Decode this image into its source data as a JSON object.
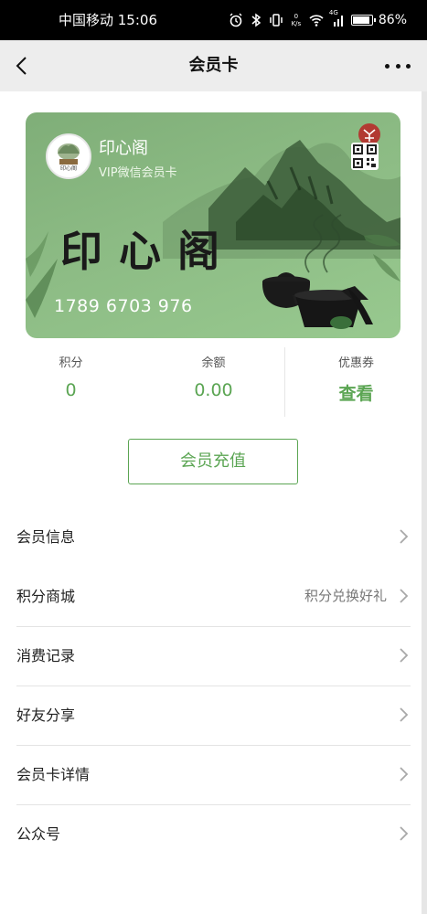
{
  "status_bar": {
    "carrier_time": "中国移动 15:06",
    "net_speed_top": "0",
    "net_speed_bottom": "K/s",
    "network_type": "4G",
    "battery": "86%"
  },
  "nav": {
    "title": "会员卡",
    "back_icon": "chevron-left-icon",
    "more_icon": "more-horizontal-icon"
  },
  "card": {
    "name": "印心阁",
    "level": "VIP微信会员卡",
    "calligraphy": "印心阁",
    "number": "1789 6703 976",
    "qr_icon": "qr-code-icon",
    "colors": {
      "card_green": "#8cbb84",
      "accent_green": "#5ba553"
    }
  },
  "stats": {
    "points_label": "积分",
    "points_value": "0",
    "balance_label": "余额",
    "balance_value": "0.00",
    "coupons_label": "优惠券",
    "coupons_value": "查看"
  },
  "recharge_label": "会员充值",
  "menu": {
    "items": [
      {
        "label": "会员信息",
        "hint": ""
      },
      {
        "label": "积分商城",
        "hint": "积分兑换好礼"
      },
      {
        "label": "消费记录",
        "hint": ""
      },
      {
        "label": "好友分享",
        "hint": ""
      },
      {
        "label": "会员卡详情",
        "hint": ""
      },
      {
        "label": "公众号",
        "hint": ""
      }
    ]
  }
}
